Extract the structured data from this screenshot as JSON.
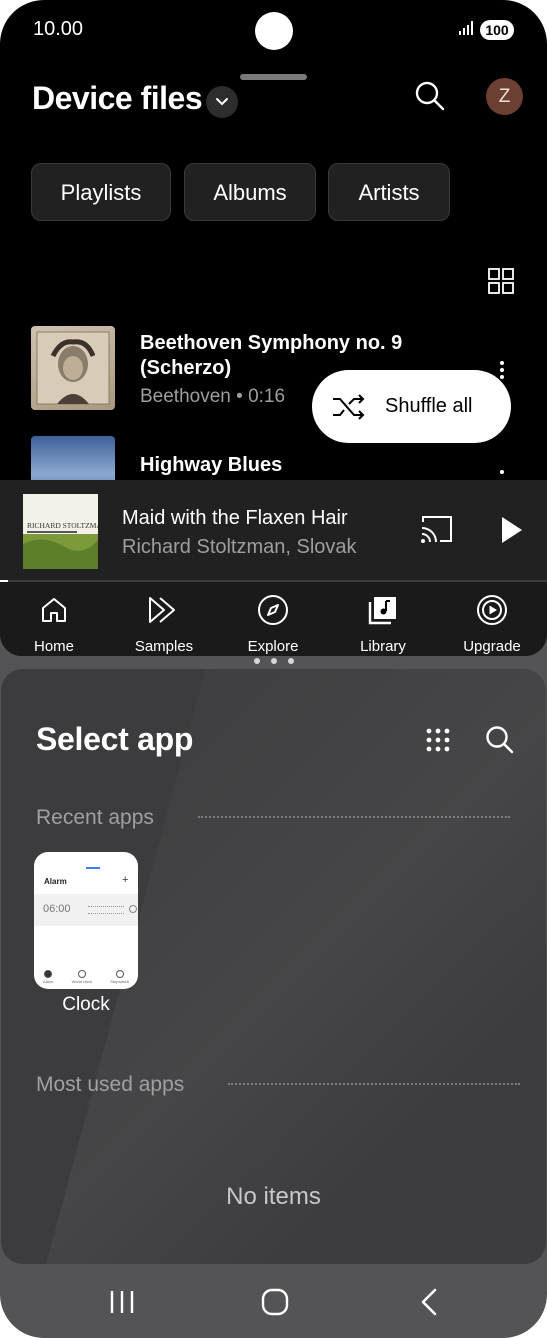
{
  "status_bar": {
    "time": "10.00",
    "battery": "100",
    "signal_icon": "signal-bars-icon"
  },
  "music_app": {
    "title": "Device files",
    "avatar_initial": "Z",
    "chips": [
      "Playlists",
      "Albums",
      "Artists"
    ],
    "tracks": [
      {
        "title_line1": "Beethoven Symphony no. 9",
        "title_line2": "(Scherzo)",
        "subtitle": "Beethoven • 0:16"
      },
      {
        "title_line1": "Highway Blues",
        "title_line2": "",
        "subtitle": ""
      }
    ],
    "shuffle_label": "Shuffle all",
    "now_playing": {
      "title": "Maid with the Flaxen Hair",
      "subtitle": "Richard Stoltzman, Slovak",
      "cover_text": "RICHARD STOLTZMAN",
      "progress_fraction": 0.015
    },
    "bottom_nav": [
      "Home",
      "Samples",
      "Explore",
      "Library",
      "Upgrade"
    ]
  },
  "select_app": {
    "title": "Select app",
    "recent_label": "Recent apps",
    "recent_apps": [
      {
        "name": "Clock",
        "thumb": {
          "header": "Alarm",
          "time": "06:00",
          "tabs": [
            "Alarm",
            "World clock",
            "Stopwatch"
          ]
        }
      }
    ],
    "most_used_label": "Most used apps",
    "empty_text": "No items"
  },
  "colors": {
    "app_bg": "#000000",
    "panel_bg": "#3c3c3e",
    "accent": "#ffffff",
    "frame": "#545456"
  }
}
